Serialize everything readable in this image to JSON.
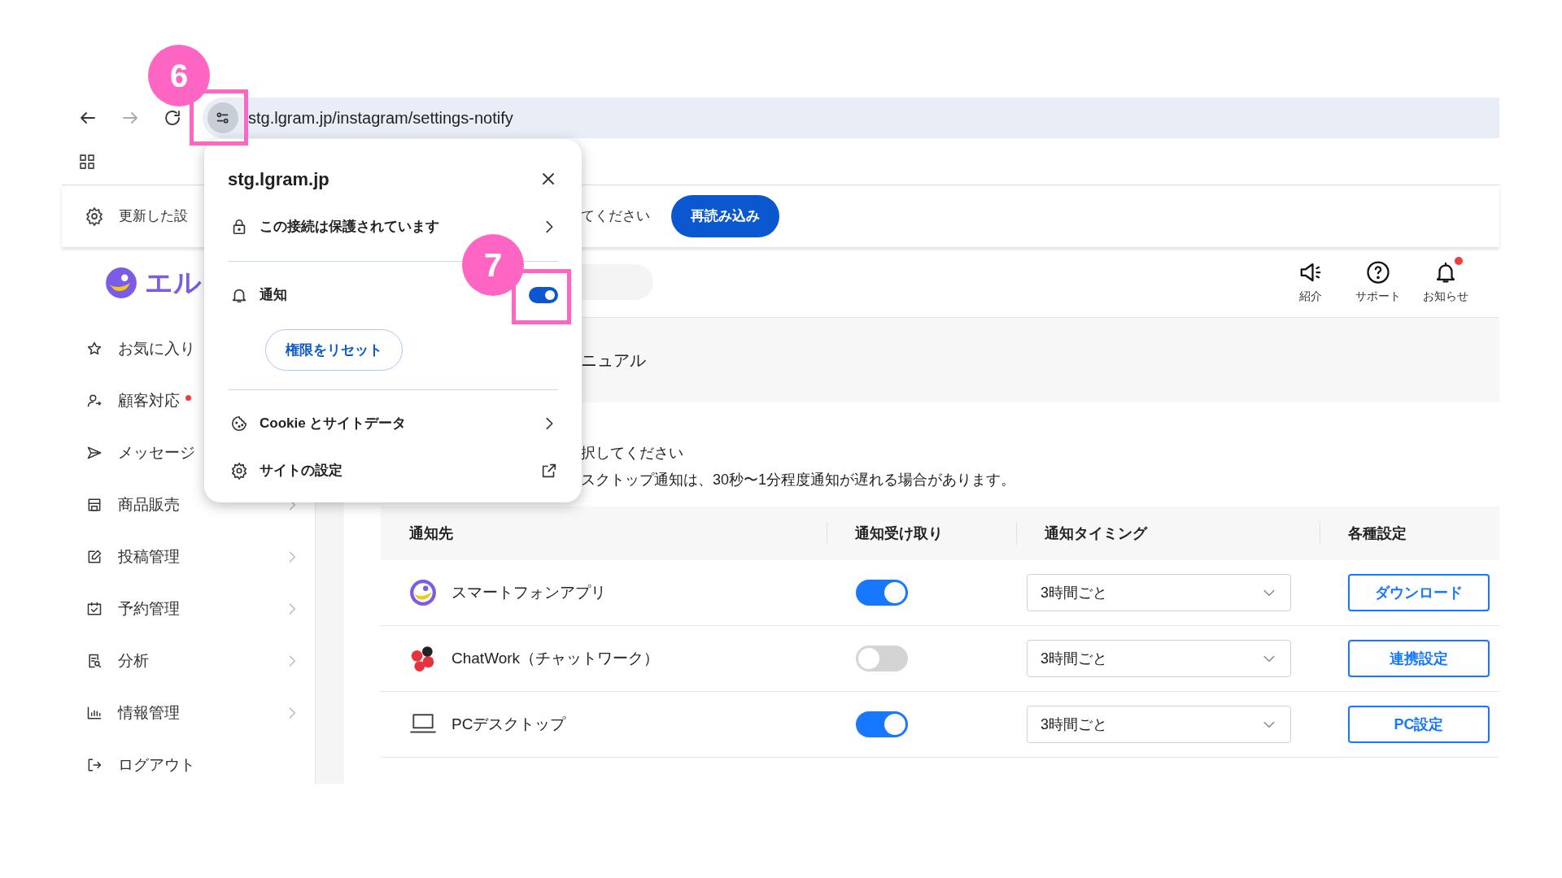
{
  "annotations": [
    {
      "label": "6"
    },
    {
      "label": "7"
    }
  ],
  "browser": {
    "url": "stg.lgram.jp/instagram/settings-notify"
  },
  "infobar": {
    "message_start": "更新した設",
    "message_end": "てください",
    "button": "再読み込み"
  },
  "popup": {
    "title": "stg.lgram.jp",
    "connection": "この接続は保護されています",
    "notification": {
      "label": "通知",
      "on": true
    },
    "reset_button": "権限をリセット",
    "cookies": "Cookie とサイトデータ",
    "site_settings": "サイトの設定"
  },
  "sidebar": {
    "logo_text": "エル",
    "items": [
      {
        "kind": "star",
        "label": "お気に入り",
        "badge": false,
        "chevron": false
      },
      {
        "kind": "person",
        "label": "顧客対応",
        "badge": true,
        "chevron": false
      },
      {
        "kind": "send",
        "label": "メッセージ",
        "badge": false,
        "chevron": false
      },
      {
        "kind": "store",
        "label": "商品販売",
        "badge": false,
        "chevron": true
      },
      {
        "kind": "edit",
        "label": "投稿管理",
        "badge": false,
        "chevron": true
      },
      {
        "kind": "calendar",
        "label": "予約管理",
        "badge": false,
        "chevron": true
      },
      {
        "kind": "report",
        "label": "分析",
        "badge": false,
        "chevron": true
      },
      {
        "kind": "chart",
        "label": "情報管理",
        "badge": false,
        "chevron": true
      },
      {
        "kind": "logout",
        "label": "ログアウト",
        "badge": false,
        "chevron": false
      }
    ]
  },
  "header": {
    "actions": [
      {
        "kind": "megaphone",
        "label": "紹介",
        "badge": false
      },
      {
        "kind": "help",
        "label": "サポート",
        "badge": false
      },
      {
        "kind": "bell",
        "label": "お知らせ",
        "badge": true
      }
    ]
  },
  "page": {
    "title": "ニュアル",
    "notes": [
      "択してください",
      "スクトップ通知は、30秒〜1分程度通知が遅れる場合があります。"
    ]
  },
  "table": {
    "columns": [
      "通知先",
      "通知受け取り",
      "通知タイミング",
      "各種設定"
    ],
    "rows": [
      {
        "kind": "app",
        "name": "スマートフォンアプリ",
        "on": true,
        "timing": "3時間ごと",
        "action": "ダウンロード"
      },
      {
        "kind": "chatwork",
        "name": "ChatWork（チャットワーク）",
        "on": false,
        "timing": "3時間ごと",
        "action": "連携設定"
      },
      {
        "kind": "desktop",
        "name": "PCデスクトップ",
        "on": true,
        "timing": "3時間ごと",
        "action": "PC設定"
      }
    ]
  }
}
